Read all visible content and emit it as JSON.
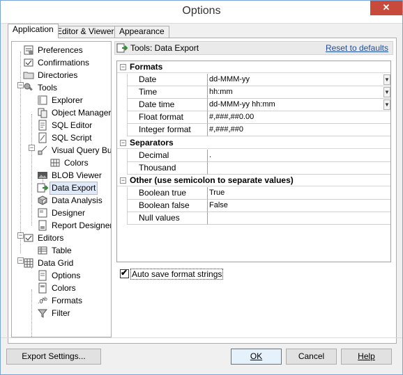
{
  "window": {
    "title": "Options",
    "close_glyph": "✕"
  },
  "tabs": [
    {
      "label": "Application",
      "active": true
    },
    {
      "label": "Editor & Viewers",
      "active": false
    },
    {
      "label": "Appearance",
      "active": false
    }
  ],
  "tree": {
    "items": [
      {
        "label": "Preferences",
        "icon": "preferences-icon"
      },
      {
        "label": "Confirmations",
        "icon": "confirmations-icon"
      },
      {
        "label": "Directories",
        "icon": "folder-icon"
      },
      {
        "label": "Tools",
        "icon": "tools-icon"
      },
      {
        "label": "Explorer",
        "icon": "explorer-icon"
      },
      {
        "label": "Object Manager",
        "icon": "object-manager-icon"
      },
      {
        "label": "SQL Editor",
        "icon": "sql-editor-icon"
      },
      {
        "label": "SQL Script",
        "icon": "sql-script-icon"
      },
      {
        "label": "Visual Query Build",
        "icon": "visual-query-icon"
      },
      {
        "label": "Colors",
        "icon": "colors-icon"
      },
      {
        "label": "BLOB Viewer",
        "icon": "blob-viewer-icon"
      },
      {
        "label": "Data Export",
        "icon": "data-export-icon",
        "selected": true
      },
      {
        "label": "Data Analysis",
        "icon": "data-analysis-icon"
      },
      {
        "label": "Designer",
        "icon": "designer-icon"
      },
      {
        "label": "Report Designer",
        "icon": "report-designer-icon"
      },
      {
        "label": "Editors",
        "icon": "editors-icon"
      },
      {
        "label": "Table",
        "icon": "table-icon"
      },
      {
        "label": "Data Grid",
        "icon": "data-grid-icon"
      },
      {
        "label": "Options",
        "icon": "options-icon"
      },
      {
        "label": "Colors",
        "icon": "colors-icon"
      },
      {
        "label": "Formats",
        "icon": "formats-icon"
      },
      {
        "label": "Filter",
        "icon": "filter-icon"
      }
    ]
  },
  "content": {
    "header_title": "Tools: Data Export",
    "reset_label": "Reset to defaults"
  },
  "grid": {
    "sections": [
      {
        "title": "Formats",
        "rows": [
          {
            "name": "Date",
            "value": "dd-MMM-yy",
            "dropdown": true
          },
          {
            "name": "Time",
            "value": "hh:mm",
            "dropdown": true
          },
          {
            "name": "Date time",
            "value": "dd-MMM-yy hh:mm",
            "dropdown": true
          },
          {
            "name": "Float format",
            "value": "#,###,##0.00",
            "dropdown": false
          },
          {
            "name": "Integer format",
            "value": "#,###,##0",
            "dropdown": false
          }
        ]
      },
      {
        "title": "Separators",
        "rows": [
          {
            "name": "Decimal",
            "value": ".",
            "dropdown": false
          },
          {
            "name": "Thousand",
            "value": "",
            "dropdown": false
          }
        ]
      },
      {
        "title": "Other (use semicolon to separate values)",
        "rows": [
          {
            "name": "Boolean true",
            "value": "True",
            "dropdown": false
          },
          {
            "name": "Boolean false",
            "value": "False",
            "dropdown": false
          },
          {
            "name": "Null values",
            "value": "",
            "dropdown": false
          }
        ]
      }
    ]
  },
  "autosave": {
    "label": "Auto save format strings",
    "checked": true,
    "check_glyph": "✔"
  },
  "buttons": {
    "export_settings": "Export Settings...",
    "ok": "OK",
    "cancel": "Cancel",
    "help": "Help"
  },
  "colors": {
    "selection": "#dfe9f7",
    "link": "#1f4ea1",
    "close": "#c74a3b"
  }
}
